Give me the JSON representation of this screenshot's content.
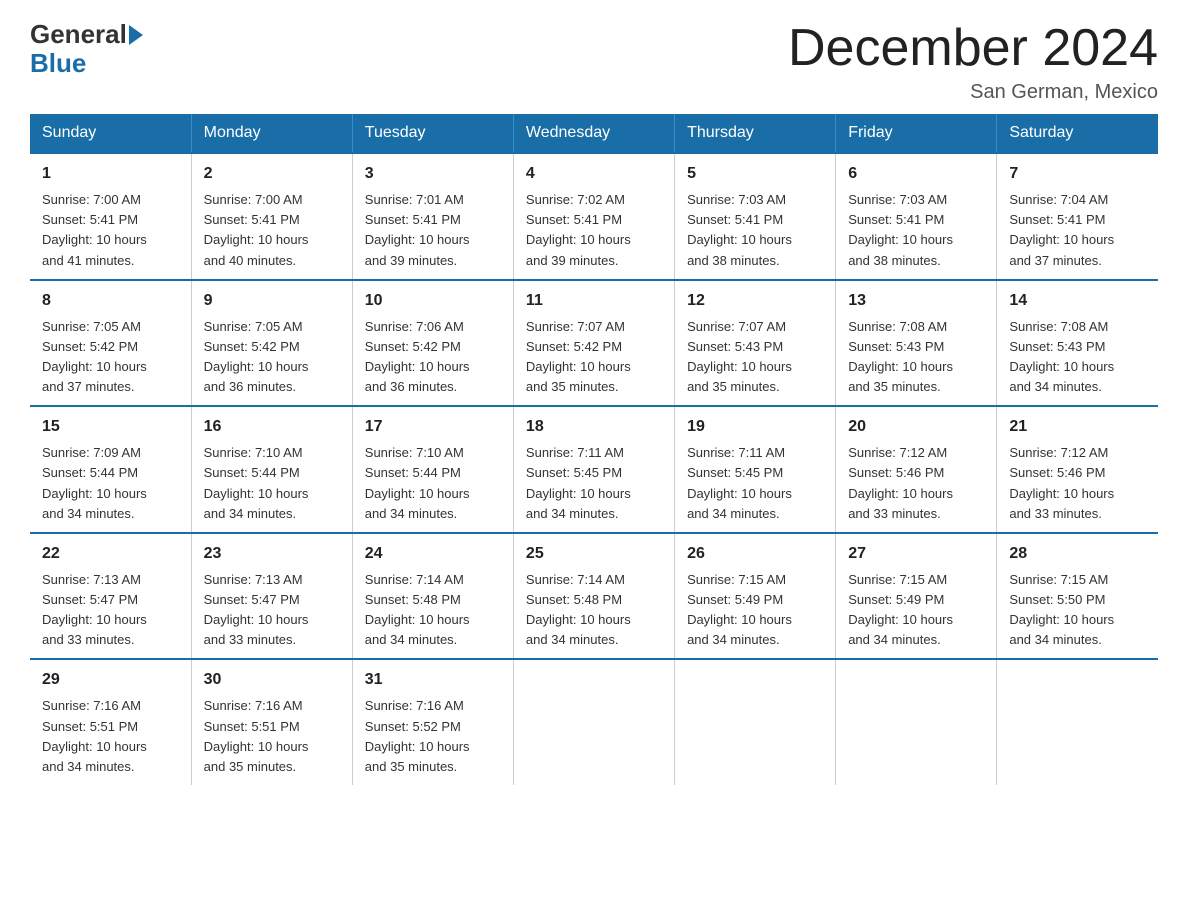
{
  "logo": {
    "general": "General",
    "blue": "Blue"
  },
  "title": "December 2024",
  "location": "San German, Mexico",
  "days_of_week": [
    "Sunday",
    "Monday",
    "Tuesday",
    "Wednesday",
    "Thursday",
    "Friday",
    "Saturday"
  ],
  "weeks": [
    [
      {
        "day": "1",
        "sunrise": "7:00 AM",
        "sunset": "5:41 PM",
        "daylight": "10 hours and 41 minutes."
      },
      {
        "day": "2",
        "sunrise": "7:00 AM",
        "sunset": "5:41 PM",
        "daylight": "10 hours and 40 minutes."
      },
      {
        "day": "3",
        "sunrise": "7:01 AM",
        "sunset": "5:41 PM",
        "daylight": "10 hours and 39 minutes."
      },
      {
        "day": "4",
        "sunrise": "7:02 AM",
        "sunset": "5:41 PM",
        "daylight": "10 hours and 39 minutes."
      },
      {
        "day": "5",
        "sunrise": "7:03 AM",
        "sunset": "5:41 PM",
        "daylight": "10 hours and 38 minutes."
      },
      {
        "day": "6",
        "sunrise": "7:03 AM",
        "sunset": "5:41 PM",
        "daylight": "10 hours and 38 minutes."
      },
      {
        "day": "7",
        "sunrise": "7:04 AM",
        "sunset": "5:41 PM",
        "daylight": "10 hours and 37 minutes."
      }
    ],
    [
      {
        "day": "8",
        "sunrise": "7:05 AM",
        "sunset": "5:42 PM",
        "daylight": "10 hours and 37 minutes."
      },
      {
        "day": "9",
        "sunrise": "7:05 AM",
        "sunset": "5:42 PM",
        "daylight": "10 hours and 36 minutes."
      },
      {
        "day": "10",
        "sunrise": "7:06 AM",
        "sunset": "5:42 PM",
        "daylight": "10 hours and 36 minutes."
      },
      {
        "day": "11",
        "sunrise": "7:07 AM",
        "sunset": "5:42 PM",
        "daylight": "10 hours and 35 minutes."
      },
      {
        "day": "12",
        "sunrise": "7:07 AM",
        "sunset": "5:43 PM",
        "daylight": "10 hours and 35 minutes."
      },
      {
        "day": "13",
        "sunrise": "7:08 AM",
        "sunset": "5:43 PM",
        "daylight": "10 hours and 35 minutes."
      },
      {
        "day": "14",
        "sunrise": "7:08 AM",
        "sunset": "5:43 PM",
        "daylight": "10 hours and 34 minutes."
      }
    ],
    [
      {
        "day": "15",
        "sunrise": "7:09 AM",
        "sunset": "5:44 PM",
        "daylight": "10 hours and 34 minutes."
      },
      {
        "day": "16",
        "sunrise": "7:10 AM",
        "sunset": "5:44 PM",
        "daylight": "10 hours and 34 minutes."
      },
      {
        "day": "17",
        "sunrise": "7:10 AM",
        "sunset": "5:44 PM",
        "daylight": "10 hours and 34 minutes."
      },
      {
        "day": "18",
        "sunrise": "7:11 AM",
        "sunset": "5:45 PM",
        "daylight": "10 hours and 34 minutes."
      },
      {
        "day": "19",
        "sunrise": "7:11 AM",
        "sunset": "5:45 PM",
        "daylight": "10 hours and 34 minutes."
      },
      {
        "day": "20",
        "sunrise": "7:12 AM",
        "sunset": "5:46 PM",
        "daylight": "10 hours and 33 minutes."
      },
      {
        "day": "21",
        "sunrise": "7:12 AM",
        "sunset": "5:46 PM",
        "daylight": "10 hours and 33 minutes."
      }
    ],
    [
      {
        "day": "22",
        "sunrise": "7:13 AM",
        "sunset": "5:47 PM",
        "daylight": "10 hours and 33 minutes."
      },
      {
        "day": "23",
        "sunrise": "7:13 AM",
        "sunset": "5:47 PM",
        "daylight": "10 hours and 33 minutes."
      },
      {
        "day": "24",
        "sunrise": "7:14 AM",
        "sunset": "5:48 PM",
        "daylight": "10 hours and 34 minutes."
      },
      {
        "day": "25",
        "sunrise": "7:14 AM",
        "sunset": "5:48 PM",
        "daylight": "10 hours and 34 minutes."
      },
      {
        "day": "26",
        "sunrise": "7:15 AM",
        "sunset": "5:49 PM",
        "daylight": "10 hours and 34 minutes."
      },
      {
        "day": "27",
        "sunrise": "7:15 AM",
        "sunset": "5:49 PM",
        "daylight": "10 hours and 34 minutes."
      },
      {
        "day": "28",
        "sunrise": "7:15 AM",
        "sunset": "5:50 PM",
        "daylight": "10 hours and 34 minutes."
      }
    ],
    [
      {
        "day": "29",
        "sunrise": "7:16 AM",
        "sunset": "5:51 PM",
        "daylight": "10 hours and 34 minutes."
      },
      {
        "day": "30",
        "sunrise": "7:16 AM",
        "sunset": "5:51 PM",
        "daylight": "10 hours and 35 minutes."
      },
      {
        "day": "31",
        "sunrise": "7:16 AM",
        "sunset": "5:52 PM",
        "daylight": "10 hours and 35 minutes."
      },
      null,
      null,
      null,
      null
    ]
  ],
  "labels": {
    "sunrise": "Sunrise:",
    "sunset": "Sunset:",
    "daylight": "Daylight:"
  }
}
